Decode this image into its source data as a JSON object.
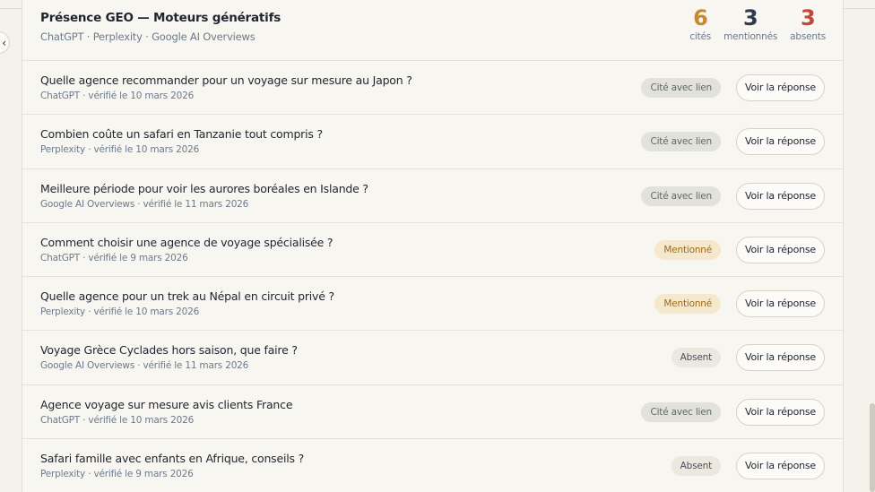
{
  "header": {
    "title": "Présence GEO — Moteurs génératifs",
    "subtitle": "ChatGPT · Perplexity · Google AI Overviews",
    "stats": [
      {
        "value": "6",
        "label": "cités",
        "color": "#c8892e"
      },
      {
        "value": "3",
        "label": "mentionnés",
        "color": "#2e3b4e"
      },
      {
        "value": "3",
        "label": "absents",
        "color": "#c0473a"
      }
    ]
  },
  "collapse_glyph": "‹",
  "button_label": "Voir la réponse",
  "rows": [
    {
      "question": "Quelle agence recommander pour un voyage sur mesure au Japon ?",
      "meta": "ChatGPT · vérifié le 10 mars 2026",
      "status": "Cité avec lien"
    },
    {
      "question": "Combien coûte un safari en Tanzanie tout compris ?",
      "meta": "Perplexity · vérifié le 10 mars 2026",
      "status": "Cité avec lien"
    },
    {
      "question": "Meilleure période pour voir les aurores boréales en Islande ?",
      "meta": "Google AI Overviews · vérifié le 11 mars 2026",
      "status": "Cité avec lien"
    },
    {
      "question": "Comment choisir une agence de voyage spécialisée ?",
      "meta": "ChatGPT · vérifié le 9 mars 2026",
      "status": "Mentionné"
    },
    {
      "question": "Quelle agence pour un trek au Népal en circuit privé ?",
      "meta": "Perplexity · vérifié le 10 mars 2026",
      "status": "Mentionné"
    },
    {
      "question": "Voyage Grèce Cyclades hors saison, que faire ?",
      "meta": "Google AI Overviews · vérifié le 11 mars 2026",
      "status": "Absent"
    },
    {
      "question": "Agence voyage sur mesure avis clients France",
      "meta": "ChatGPT · vérifié le 10 mars 2026",
      "status": "Cité avec lien"
    },
    {
      "question": "Safari famille avec enfants en Afrique, conseils ?",
      "meta": "Perplexity · vérifié le 9 mars 2026",
      "status": "Absent"
    }
  ]
}
